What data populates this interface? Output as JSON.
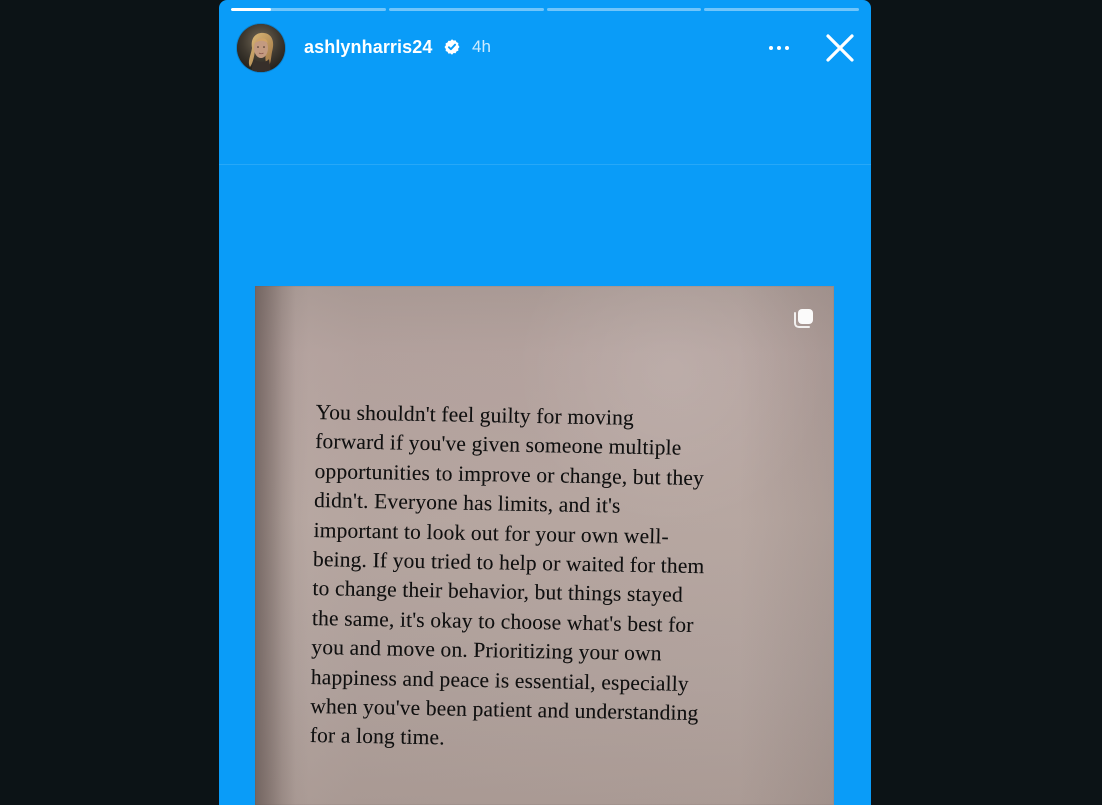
{
  "story": {
    "progress": [
      1,
      0,
      0,
      0
    ],
    "first_segment_fraction": 0.26
  },
  "header": {
    "username": "ashlynharris24",
    "time": "4h",
    "verified": true
  },
  "post": {
    "quote_lines": [
      "You shouldn't feel guilty for moving",
      "forward if you've given someone multiple",
      "opportunities to improve or change, but they",
      "didn't. Everyone has limits, and it's",
      "important to look out for your own well-",
      "being. If you tried to help or waited for them",
      "to change their behavior, but things stayed",
      "the same, it's okay to choose what's best for",
      "you and move on. Prioritizing your own",
      "happiness and peace is essential, especially",
      "when you've been patient and understanding",
      "for a long time."
    ]
  },
  "icons": {
    "verified": "verified-badge-icon",
    "more": "more-options-icon",
    "close": "close-icon",
    "copy": "copy-icon"
  },
  "colors": {
    "background": "#0c1316",
    "story_background": "#0a9cf8",
    "photo_background": "#b7a7a1",
    "text": "#101010",
    "white": "#ffffff"
  }
}
